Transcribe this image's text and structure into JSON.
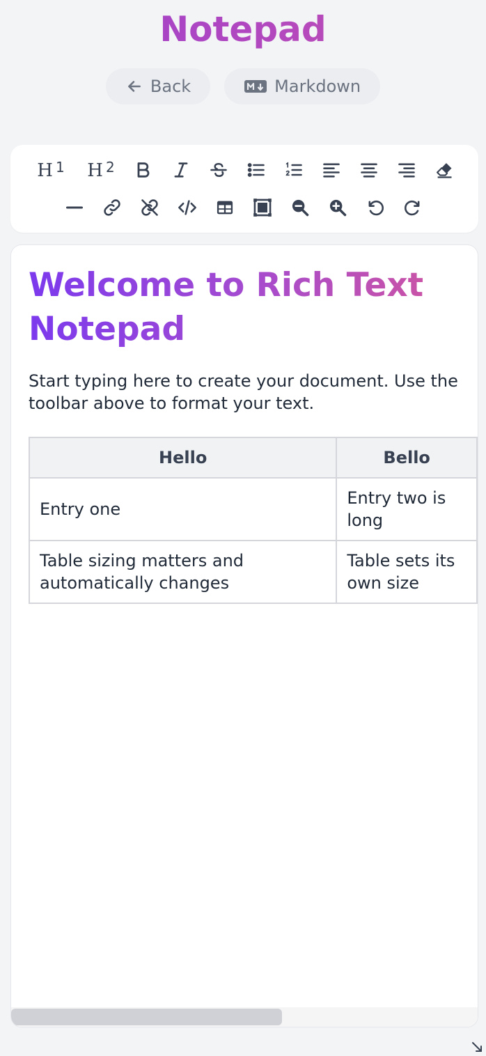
{
  "app": {
    "title": "Notepad"
  },
  "top_buttons": {
    "back_label": "Back",
    "markdown_label": "Markdown"
  },
  "toolbar": {
    "rows": [
      [
        "heading-1",
        "heading-2",
        "bold",
        "italic",
        "strikethrough",
        "bullet-list",
        "ordered-list",
        "align-left",
        "align-center",
        "align-right",
        "clear-format"
      ],
      [
        "horizontal-rule",
        "link",
        "unlink",
        "code",
        "table",
        "image",
        "zoom-out",
        "zoom-in",
        "undo",
        "redo"
      ]
    ],
    "h1_glyph": "H",
    "h1_num": "1",
    "h2_glyph": "H",
    "h2_num": "2"
  },
  "document": {
    "heading": "Welcome to Rich Text Notepad",
    "paragraph": "Start typing here to create your document. Use the toolbar above to format your text.",
    "table": {
      "headers": [
        "Hello",
        "Bello"
      ],
      "rows": [
        [
          "Entry one",
          "Entry two is long"
        ],
        [
          "Table sizing matters and automatically changes",
          "Table sets its own size"
        ]
      ]
    }
  },
  "scroll": {
    "horizontal_fraction_visible": 0.58
  },
  "colors": {
    "gradient_start": "#7c3aed",
    "gradient_end": "#d0559f",
    "background": "#f3f4f6"
  }
}
